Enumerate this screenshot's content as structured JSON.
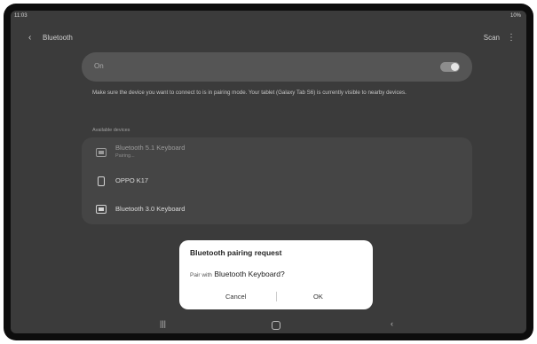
{
  "status_bar": {
    "time": "11:03",
    "battery": "10%"
  },
  "app_bar": {
    "back_glyph": "‹",
    "title": "Bluetooth",
    "scan_label": "Scan",
    "more_glyph": "⋮"
  },
  "toggle": {
    "label": "On",
    "state": true
  },
  "hint_text": "Make sure the device you want to connect to is in pairing mode. Your tablet (Galaxy Tab S6) is currently visible to nearby devices.",
  "section_header": "Available devices",
  "devices": [
    {
      "name": "Bluetooth 5.1 Keyboard",
      "subtitle": "Pairing...",
      "icon": "keyboard-icon"
    },
    {
      "name": "OPPO K17",
      "subtitle": "",
      "icon": "phone-icon"
    },
    {
      "name": "Bluetooth 3.0 Keyboard",
      "subtitle": "",
      "icon": "keyboard-icon"
    }
  ],
  "dialog": {
    "title": "Bluetooth pairing request",
    "prefix": "Pair with",
    "device": "Bluetooth Keyboard?",
    "cancel_label": "Cancel",
    "ok_label": "OK"
  },
  "nav": {
    "recents_glyph": "|||",
    "back_glyph": "‹"
  },
  "colors": {
    "screen_bg": "#3b3b3b",
    "card_bg": "#454545",
    "dialog_bg": "#ffffff"
  }
}
